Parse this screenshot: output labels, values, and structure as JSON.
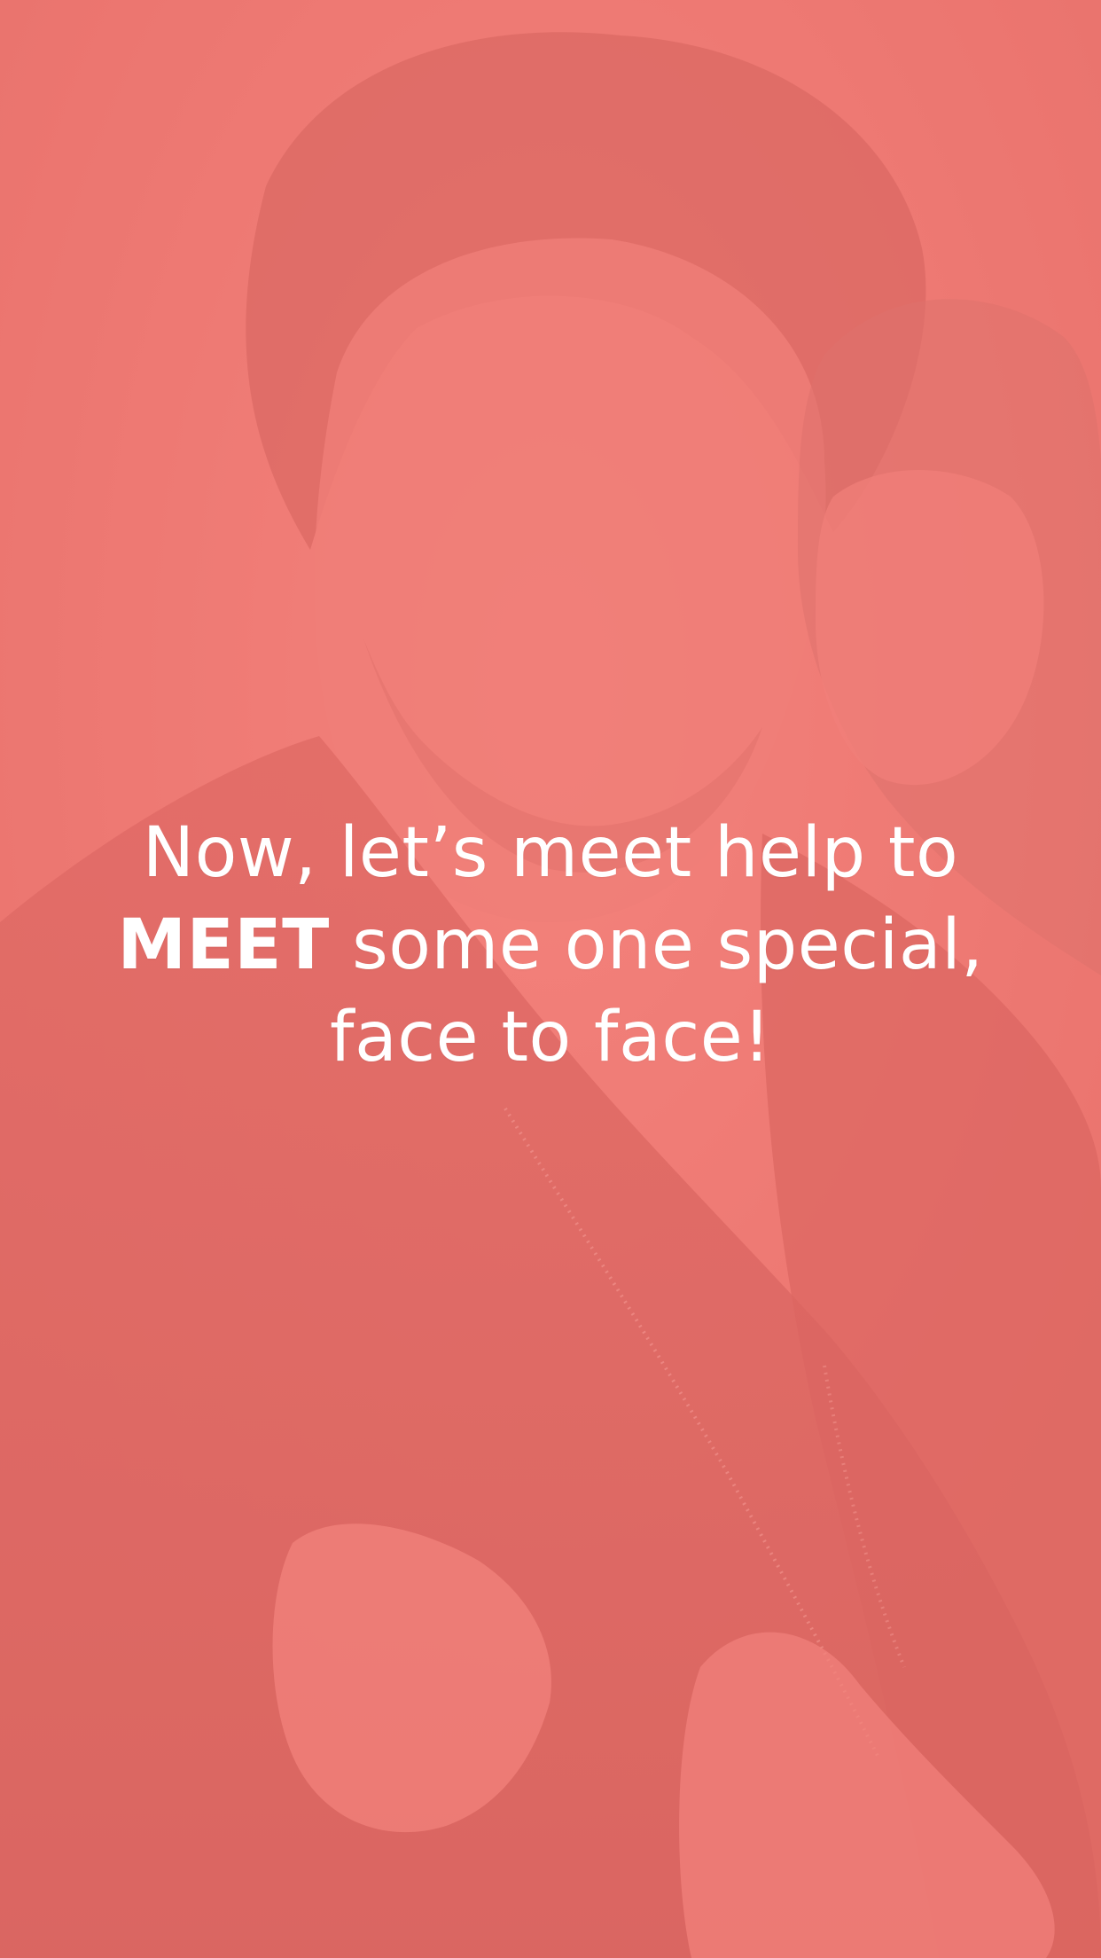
{
  "screen": {
    "headline": {
      "line1": "Now, let’s meet help to",
      "line2_strong": "MEET",
      "line2_rest": " some one special,",
      "line3": "face to face!"
    },
    "background": {
      "image": "couple-hugging-photo",
      "tint_color": "#f07c76"
    }
  }
}
